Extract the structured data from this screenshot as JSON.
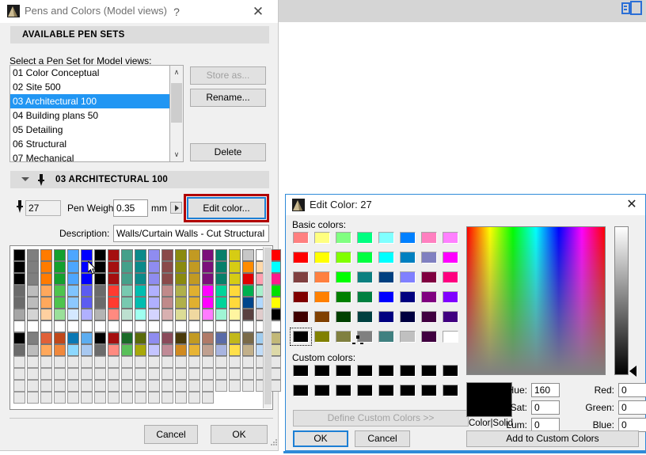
{
  "pens_dialog": {
    "title": "Pens and Colors (Model views)",
    "help_label": "?",
    "close_label": "✕",
    "available_header": "AVAILABLE PEN SETS",
    "select_label": "Select a Pen Set for Model views:",
    "pen_sets": [
      {
        "label": "01 Color Conceptual",
        "selected": false
      },
      {
        "label": "02 Site 500",
        "selected": false
      },
      {
        "label": "03 Architectural 100",
        "selected": true
      },
      {
        "label": "04 Building plans 50",
        "selected": false
      },
      {
        "label": "05 Detailing",
        "selected": false
      },
      {
        "label": "06 Structural",
        "selected": false
      },
      {
        "label": "07 Mechanical",
        "selected": false
      }
    ],
    "buttons": {
      "store_as": "Store as...",
      "rename": "Rename...",
      "delete": "Delete",
      "cancel": "Cancel",
      "ok": "OK"
    },
    "scrollbar": {
      "up": "∧",
      "down": "∨"
    },
    "pen_section": {
      "header": "03 ARCHITECTURAL 100",
      "pen_index": "27",
      "pen_weight_label": "Pen Weight:",
      "pen_weight_value": "0.35",
      "unit": "mm",
      "edit_color_label": "Edit color...",
      "description_label": "Description:",
      "description_value": "Walls/Curtain Walls - Cut Structural",
      "highlight_color": "#b00000",
      "focus_color": "#1d7fd4"
    },
    "palette": {
      "columns": 19,
      "rows": 13,
      "colors": [
        [
          "#000000",
          "#7f7f7f",
          "#ff7b00",
          "#14a02e",
          "#4da6ff",
          "#0000ff",
          "#000000",
          "#a50f0f",
          "#45a08a",
          "#0b8a8a",
          "#8f8cf0",
          "#8a4a4a",
          "#8a8a0f",
          "#c29a22",
          "#7b0f7b",
          "#07806a",
          "#d6cc14",
          "#c7c7c7",
          "#ffffff",
          "#ff0000"
        ],
        [
          "#000000",
          "#7f7f7f",
          "#ff7b00",
          "#14a02e",
          "#4da6ff",
          "#0000ff",
          "#000000",
          "#a50f0f",
          "#45a08a",
          "#0b8a8a",
          "#8f8cf0",
          "#8a4a4a",
          "#8a8a0f",
          "#c29a22",
          "#7b0f7b",
          "#07806a",
          "#d6cc14",
          "#ff8c00",
          "#ffd9aa",
          "#00ffff"
        ],
        [
          "#000000",
          "#7f7f7f",
          "#ff7b00",
          "#14a02e",
          "#4da6ff",
          "#0000ff",
          "#000000",
          "#a50f0f",
          "#45a08a",
          "#0b8a8a",
          "#8f8cf0",
          "#8a4a4a",
          "#8a8a0f",
          "#c29a22",
          "#7b0f7b",
          "#07806a",
          "#d6cc14",
          "#e00000",
          "#ffa0b0",
          "#ff1a8c"
        ],
        [
          "#6b6b6b",
          "#bcbcbc",
          "#ffa85c",
          "#4ec44e",
          "#7fc4ff",
          "#5c5cf0",
          "#6b6b6b",
          "#ff3b30",
          "#78c9b0",
          "#00bdb0",
          "#b0b0ff",
          "#c08a8a",
          "#b0b04a",
          "#e0b030",
          "#ff00ff",
          "#00d49a",
          "#ffd93b",
          "#00b050",
          "#a8f0cc",
          "#00e000"
        ],
        [
          "#6b6b6b",
          "#bcbcbc",
          "#ffa85c",
          "#4ec44e",
          "#8cc8ff",
          "#5c5cf0",
          "#6b6b6b",
          "#ff3b30",
          "#78c9b0",
          "#00bdb0",
          "#b0b0ff",
          "#c08a8a",
          "#b0b04a",
          "#e0b030",
          "#ff00ff",
          "#00d49a",
          "#ffd93b",
          "#00468c",
          "#b0d8ff",
          "#ffff00"
        ],
        [
          "#a6a6a6",
          "#d4d4d4",
          "#ffd0a0",
          "#9ae09a",
          "#d4e8ff",
          "#b0b0ff",
          "#b4b4b4",
          "#ff8a80",
          "#bde0d0",
          "#9ffff0",
          "#d4d4ff",
          "#d8b0b0",
          "#dcdc96",
          "#f0d8a0",
          "#ff7bff",
          "#9ff5d4",
          "#fff5a0",
          "#5a4040",
          "#e0cccc",
          "#000000"
        ],
        [
          "#ffffff",
          "#ffffff",
          "#ffffff",
          "#ffffff",
          "#ffffff",
          "#ffffff",
          "#ffffff",
          "#ffffff",
          "#ffffff",
          "#ffffff",
          "#ffffff",
          "#ffffff",
          "#ffffff",
          "#ffffff",
          "#ffffff",
          "#ffffff",
          "#ffffff",
          "#ffffff",
          "#ffffff",
          "#ffffff"
        ],
        [
          "#000000",
          "#7f7f7f",
          "#e06038",
          "#c0481a",
          "#0a78b4",
          "#5cadf0",
          "#000000",
          "#a50f0f",
          "#1a6b28",
          "#5a6b0a",
          "#8f8cf0",
          "#8a4a5a",
          "#4a3a0a",
          "#c29a22",
          "#b07a68",
          "#5a6ba8",
          "#c2b81a",
          "#7a6a48",
          "#a0cdf0",
          "#c2b878"
        ],
        [
          "#6b6b6b",
          "#bcbcbc",
          "#ffa85c",
          "#f0883c",
          "#8cd8ff",
          "#a8c8f0",
          "#6b6b6b",
          "#ff8a80",
          "#5ac05a",
          "#a8a80a",
          "#c4c4ff",
          "#c08a96",
          "#d08a20",
          "#e8b434",
          "#c0a090",
          "#a8b4e0",
          "#ffe04a",
          "#c2b08a",
          "#c0dcf8",
          "#ddd9a8"
        ],
        [
          "#e8e8e8",
          "#e8e8e8",
          "#e8e8e8",
          "#e8e8e8",
          "#e8e8e8",
          "#e8e8e8",
          "#e8e8e8",
          "#e8e8e8",
          "#e8e8e8",
          "#e8e8e8",
          "#e8e8e8",
          "#e8e8e8",
          "#e8e8e8",
          "#e8e8e8",
          "#e8e8e8",
          "#e8e8e8",
          "#e8e8e8",
          "#e8e8e8",
          "#e8e8e8",
          "#e8e8e8"
        ],
        [
          "#e8e8e8",
          "#e8e8e8",
          "#e8e8e8",
          "#e8e8e8",
          "#e8e8e8",
          "#e8e8e8",
          "#e8e8e8",
          "#e8e8e8",
          "#e8e8e8",
          "#e8e8e8",
          "#e8e8e8",
          "#e8e8e8",
          "#e8e8e8",
          "#e8e8e8",
          "#e8e8e8",
          "#e8e8e8",
          "#e8e8e8",
          "#e8e8e8",
          "#e8e8e8",
          "#e8e8e8"
        ],
        [
          "#e8e8e8",
          "#e8e8e8",
          "#e8e8e8",
          "#e8e8e8",
          "#e8e8e8",
          "#e8e8e8",
          "#e8e8e8",
          "#e8e8e8",
          "#e8e8e8",
          "#e8e8e8",
          "#e8e8e8",
          "#e8e8e8",
          "#e8e8e8",
          "#e8e8e8",
          "#e8e8e8",
          "#e8e8e8",
          "#e8e8e8",
          "#e8e8e8",
          "#e8e8e8",
          "#e8e8e8"
        ],
        [
          "#e8e8e8",
          "#e8e8e8",
          "#e8e8e8",
          "#e8e8e8",
          "#e8e8e8",
          "#e8e8e8",
          "#e8e8e8",
          "#e8e8e8",
          "#e8e8e8",
          "#e8e8e8",
          "#e8e8e8",
          "#e8e8e8",
          "#e8e8e8",
          "#e8e8e8",
          "#e8e8e8"
        ]
      ]
    }
  },
  "edit_color_dialog": {
    "title": "Edit Color: 27",
    "close_label": "✕",
    "basic_colors_label": "Basic colors:",
    "custom_colors_label": "Custom colors:",
    "define_custom_label": "Define Custom Colors >>",
    "add_custom_label": "Add to Custom Colors",
    "ok_label": "OK",
    "cancel_label": "Cancel",
    "color_solid_label": "Color|Solid",
    "current_color": "#000000",
    "selected_basic_index": 40,
    "basic_colors": [
      "#ff8080",
      "#ffff80",
      "#80ff80",
      "#00ff80",
      "#80ffff",
      "#0080ff",
      "#ff80c0",
      "#ff80ff",
      "#ff0000",
      "#ffff00",
      "#80ff00",
      "#00ff40",
      "#00ffff",
      "#0080c0",
      "#8080c0",
      "#ff00ff",
      "#804040",
      "#ff8040",
      "#00ff00",
      "#0c8080",
      "#004080",
      "#8080ff",
      "#800040",
      "#ff0080",
      "#800000",
      "#ff8000",
      "#008000",
      "#008040",
      "#0000ff",
      "#000080",
      "#800080",
      "#8000ff",
      "#400000",
      "#804000",
      "#004000",
      "#004040",
      "#000080",
      "#000040",
      "#400040",
      "#400080",
      "#000000",
      "#808000",
      "#808040",
      "#808080",
      "#408080",
      "#c0c0c0",
      "#400040",
      "#ffffff"
    ],
    "custom_colors": [
      "#000000",
      "#000000",
      "#000000",
      "#000000",
      "#000000",
      "#000000",
      "#000000",
      "#000000",
      "#000000",
      "#000000",
      "#000000",
      "#000000",
      "#000000",
      "#000000",
      "#000000",
      "#000000"
    ],
    "fields": {
      "hue_label": "Hue:",
      "hue_value": "160",
      "sat_label": "Sat:",
      "sat_value": "0",
      "lum_label": "Lum:",
      "lum_value": "0",
      "red_label": "Red:",
      "red_value": "0",
      "green_label": "Green:",
      "green_value": "0",
      "blue_label": "Blue:",
      "blue_value": "0"
    }
  }
}
